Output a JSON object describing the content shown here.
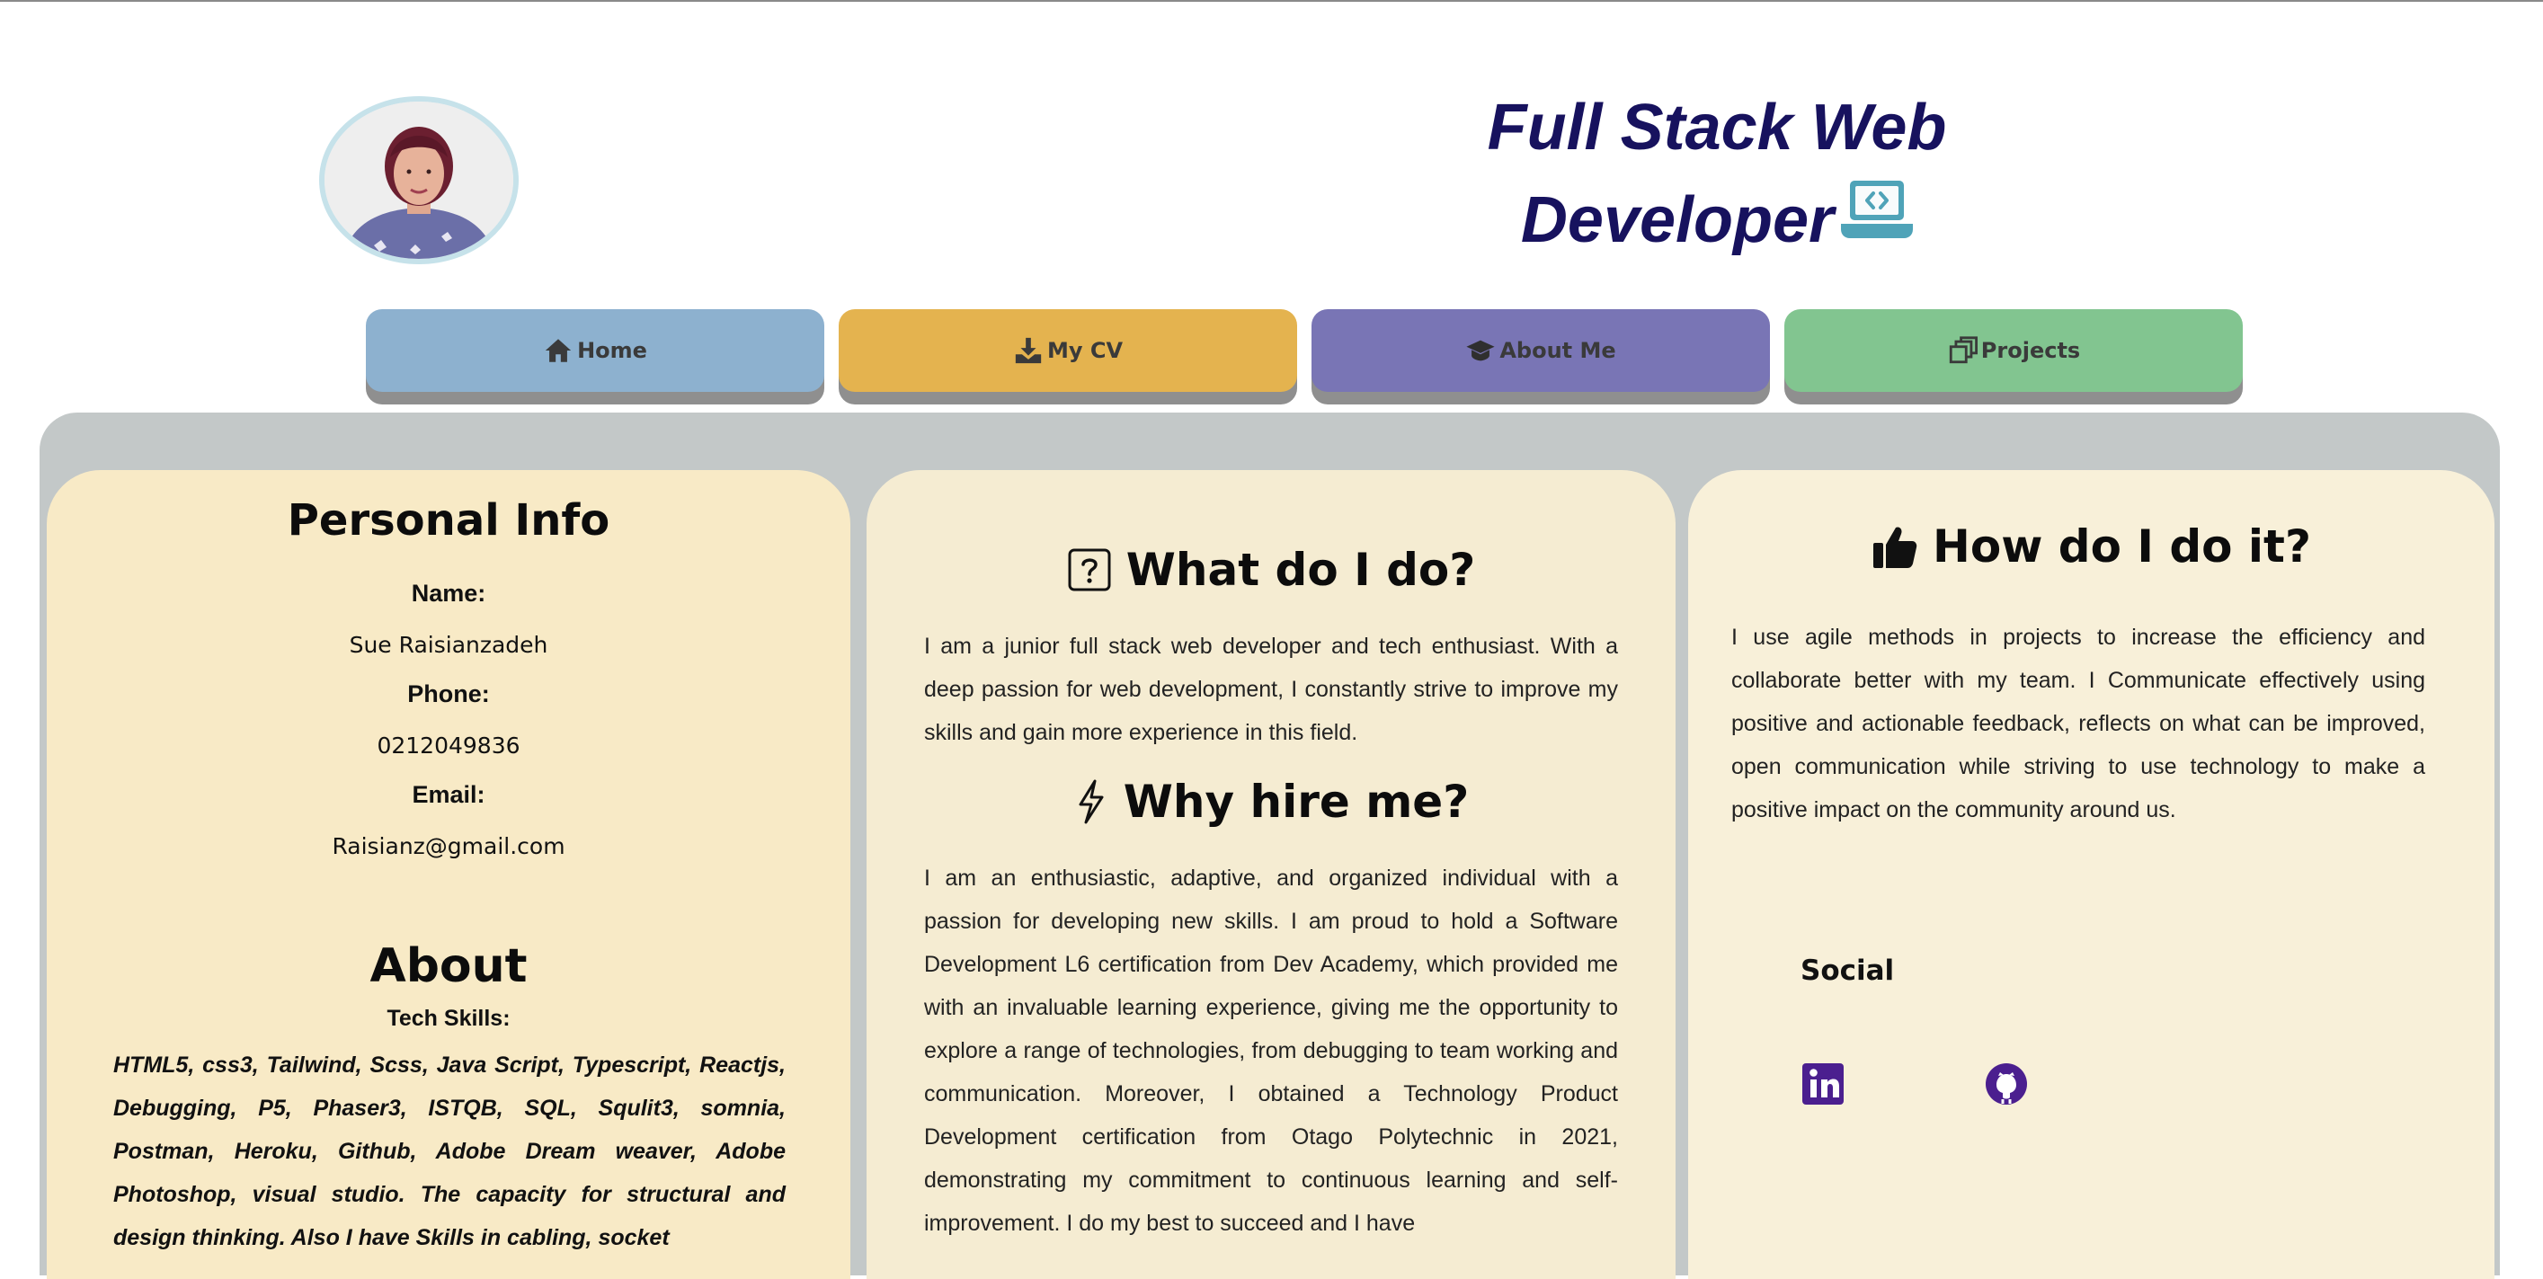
{
  "header": {
    "title_line1": "Full Stack Web",
    "title_line2": "Developer"
  },
  "nav": {
    "home": "Home",
    "cv": "My CV",
    "about": "About Me",
    "projects": "Projects"
  },
  "personal_info": {
    "heading": "Personal Info",
    "name_label": "Name:",
    "name_value": "Sue Raisianzadeh",
    "phone_label": "Phone:",
    "phone_value": "0212049836",
    "email_label": "Email:",
    "email_value": "Raisianz@gmail.com"
  },
  "about": {
    "heading": "About",
    "skills_label": "Tech Skills:",
    "skills_text": "HTML5, css3, Tailwind, Scss, Java Script, Typescript, Reactjs, Debugging, P5, Phaser3, ISTQB, SQL, Squlit3, somnia, Postman, Heroku, Github, Adobe Dream weaver, Adobe Photoshop, visual studio. The capacity for structural and design thinking. Also I have Skills in cabling, socket"
  },
  "what": {
    "heading": "What do I do?",
    "text": "I am a junior full stack web developer and tech enthusiast. With a deep passion for web development, I constantly strive to improve my skills and gain more experience in this field."
  },
  "why": {
    "heading": "Why hire me?",
    "text": "I am an enthusiastic, adaptive, and organized individual with a passion for developing new skills. I am proud to hold a Software Development L6 certification from Dev Academy, which provided me with an invaluable learning experience, giving me the opportunity to explore a range of technologies, from debugging to team working and communication. Moreover, I obtained a Technology Product Development certification from Otago Polytechnic in 2021, demonstrating my commitment to continuous learning and self-improvement. I do my best to succeed and I have"
  },
  "how": {
    "heading": "How do I do it?",
    "text": "I use agile methods in projects to increase the efficiency and collaborate better with my team. I Communicate effectively using positive and actionable feedback, reflects on what can be improved, open communication while striving to use technology to make a positive impact on the community around us."
  },
  "social": {
    "heading": "Social",
    "icons": [
      "linkedin-icon",
      "github-icon"
    ]
  },
  "colors": {
    "title": "#17125e",
    "nav_home": "#8db1cf",
    "nav_cv": "#e4b34f",
    "nav_about": "#7975b5",
    "nav_projects": "#82c590",
    "main_bg": "#c3c8c8",
    "social_icon": "#4b1f8f"
  }
}
